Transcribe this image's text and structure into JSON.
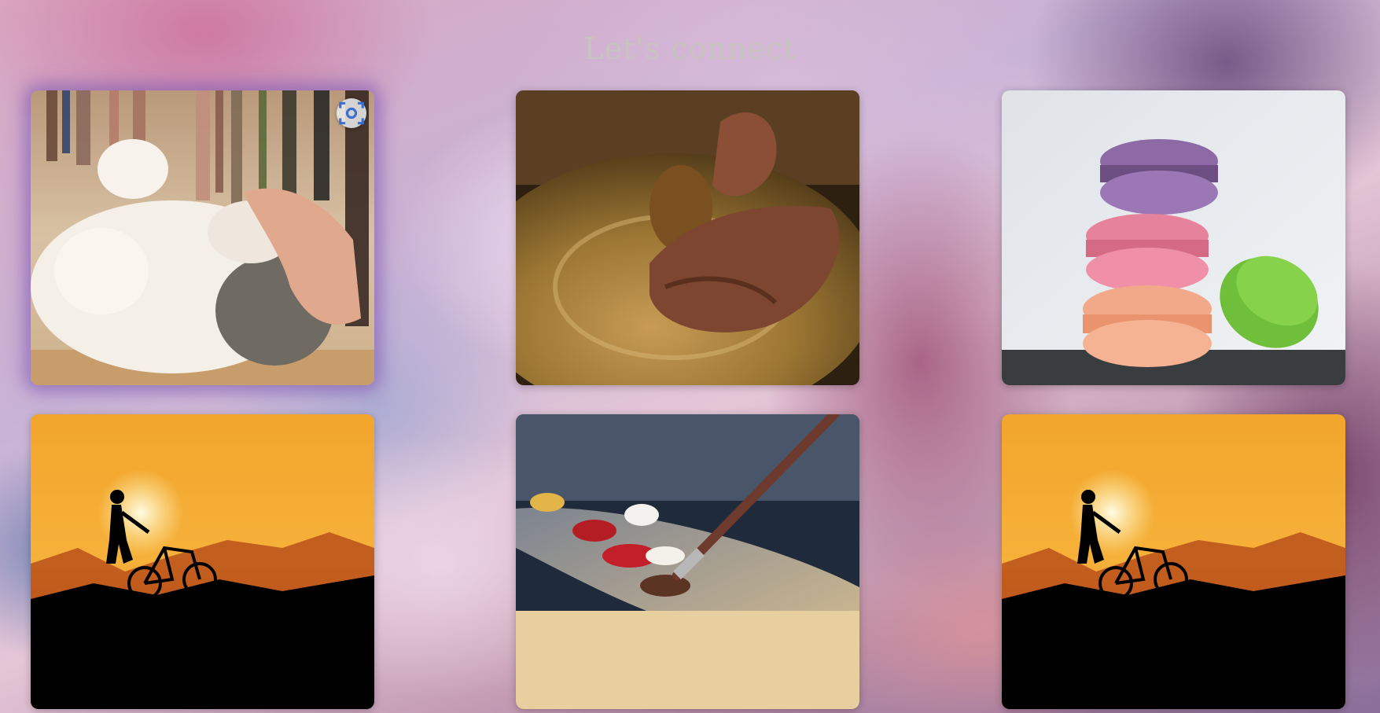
{
  "page": {
    "title": "Let's connect"
  },
  "gallery": {
    "items": [
      {
        "subject": "cat-being-petted"
      },
      {
        "subject": "pottery-wheel-hands"
      },
      {
        "subject": "stacked-macarons"
      },
      {
        "subject": "cyclist-sunset-silhouette"
      },
      {
        "subject": "paint-palette-brush"
      },
      {
        "subject": "cyclist-sunset-silhouette"
      }
    ],
    "overlay_icon": "visual-search-icon"
  },
  "colors": {
    "title": "#c9c3bf",
    "highlight_glow": "#825ab4"
  }
}
